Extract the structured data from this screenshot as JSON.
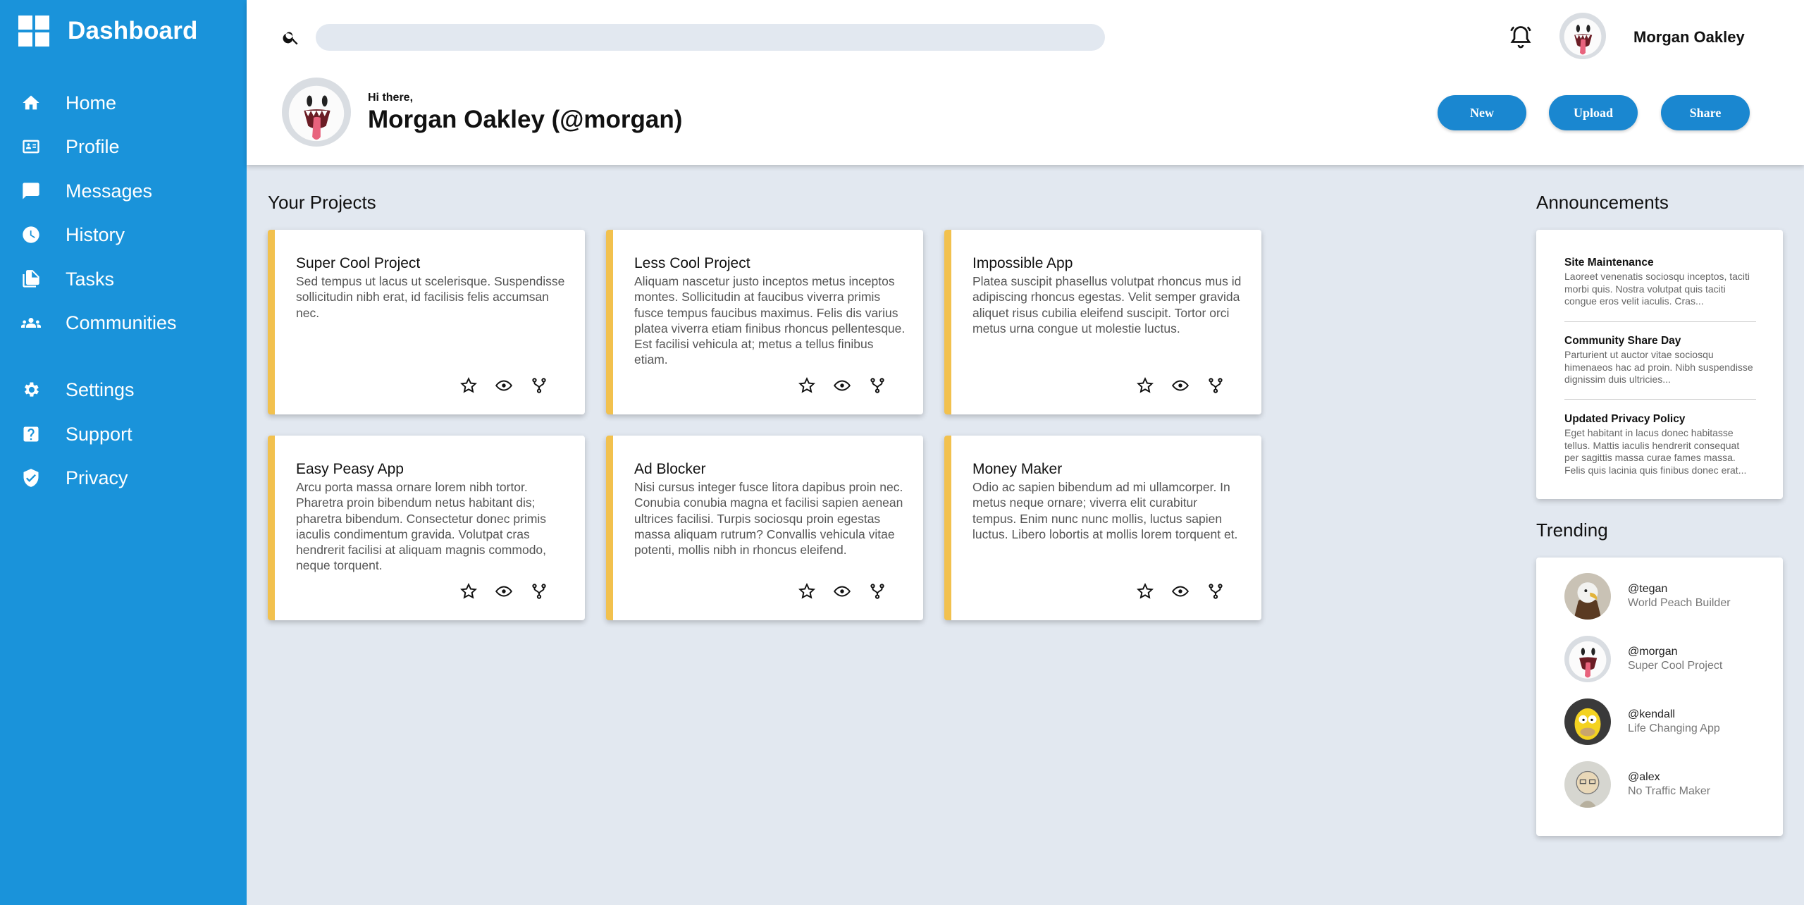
{
  "sidebar": {
    "title": "Dashboard",
    "items": [
      {
        "label": "Home",
        "icon": "home-icon"
      },
      {
        "label": "Profile",
        "icon": "id-card-icon"
      },
      {
        "label": "Messages",
        "icon": "message-icon"
      },
      {
        "label": "History",
        "icon": "clock-icon"
      },
      {
        "label": "Tasks",
        "icon": "file-copy-icon"
      },
      {
        "label": "Communities",
        "icon": "group-icon"
      },
      {
        "label": "Settings",
        "icon": "gear-icon"
      },
      {
        "label": "Support",
        "icon": "help-icon"
      },
      {
        "label": "Privacy",
        "icon": "shield-icon"
      }
    ]
  },
  "header": {
    "search_placeholder": "",
    "user_name": "Morgan Oakley",
    "greeting": "Hi there,",
    "full_name": "Morgan Oakley (@morgan)",
    "buttons": {
      "new": "New",
      "upload": "Upload",
      "share": "Share"
    }
  },
  "projects": {
    "title": "Your Projects",
    "cards": [
      {
        "title": "Super Cool Project",
        "desc": "Sed tempus ut lacus ut scelerisque. Suspendisse sollicitudin nibh erat, id facilisis felis accumsan nec."
      },
      {
        "title": "Less Cool Project",
        "desc": "Aliquam nascetur justo inceptos metus inceptos montes. Sollicitudin at faucibus viverra primis fusce tempus faucibus maximus. Felis dis varius platea viverra etiam finibus rhoncus pellentesque. Est facilisi vehicula at; metus a tellus finibus etiam."
      },
      {
        "title": "Impossible App",
        "desc": "Platea suscipit phasellus volutpat rhoncus mus id adipiscing rhoncus egestas. Velit semper gravida aliquet risus cubilia eleifend suscipit. Tortor orci metus urna congue ut molestie luctus."
      },
      {
        "title": "Easy Peasy App",
        "desc": "Arcu porta massa ornare lorem nibh tortor. Pharetra proin bibendum netus habitant dis; pharetra bibendum. Consectetur donec primis iaculis condimentum gravida. Volutpat cras hendrerit facilisi at aliquam magnis commodo, neque torquent."
      },
      {
        "title": "Ad Blocker",
        "desc": "Nisi cursus integer fusce litora dapibus proin nec. Conubia conubia magna et facilisi sapien aenean ultrices facilisi. Turpis sociosqu proin egestas massa aliquam rutrum? Convallis vehicula vitae potenti, mollis nibh in rhoncus eleifend."
      },
      {
        "title": "Money Maker",
        "desc": "Odio ac sapien bibendum ad mi ullamcorper. In metus neque ornare; viverra elit curabitur tempus. Enim nunc nunc mollis, luctus sapien luctus. Libero lobortis at mollis lorem torquent et."
      }
    ]
  },
  "announcements": {
    "title": "Announcements",
    "items": [
      {
        "title": "Site Maintenance",
        "body": "Laoreet venenatis sociosqu inceptos, taciti morbi quis. Nostra volutpat quis taciti congue eros velit iaculis. Cras..."
      },
      {
        "title": "Community Share Day",
        "body": "Parturient ut auctor vitae sociosqu himenaeos hac ad proin. Nibh suspendisse dignissim duis ultricies..."
      },
      {
        "title": "Updated Privacy Policy",
        "body": "Eget habitant in lacus donec habitasse tellus. Mattis iaculis hendrerit consequat per sagittis massa curae fames massa. Felis quis lacinia quis finibus donec erat..."
      }
    ]
  },
  "trending": {
    "title": "Trending",
    "items": [
      {
        "handle": "@tegan",
        "desc": "World Peach Builder"
      },
      {
        "handle": "@morgan",
        "desc": "Super Cool Project"
      },
      {
        "handle": "@kendall",
        "desc": "Life Changing App"
      },
      {
        "handle": "@alex",
        "desc": "No Traffic Maker"
      }
    ]
  }
}
